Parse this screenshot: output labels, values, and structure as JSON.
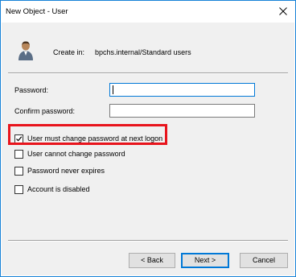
{
  "window": {
    "title": "New Object - User"
  },
  "header": {
    "create_in_label": "Create in:",
    "create_in_path": "bpchs.internal/Standard users"
  },
  "form": {
    "password_label": "Password:",
    "password_value": "",
    "confirm_password_label": "Confirm password:",
    "confirm_password_value": ""
  },
  "options": [
    {
      "label": "User must change password at next logon",
      "checked": true
    },
    {
      "label": "User cannot change password",
      "checked": false
    },
    {
      "label": "Password never expires",
      "checked": false
    },
    {
      "label": "Account is disabled",
      "checked": false
    }
  ],
  "buttons": {
    "back": "< Back",
    "next": "Next >",
    "cancel": "Cancel"
  },
  "colors": {
    "window_border": "#1883d7",
    "highlight": "#e8141c",
    "focus": "#0078d7"
  },
  "icons": {
    "close": "close-icon",
    "user": "user-icon",
    "check": "checkmark-icon"
  }
}
